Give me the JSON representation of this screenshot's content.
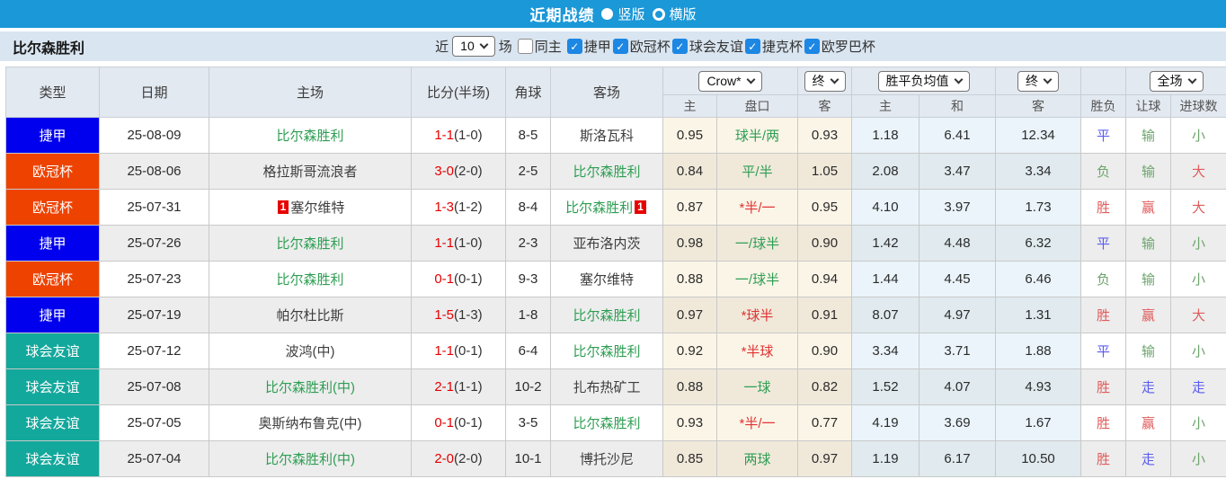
{
  "title_bar": {
    "title": "近期战绩",
    "options": [
      {
        "label": "竖版",
        "selected": true
      },
      {
        "label": "横版",
        "selected": false
      }
    ]
  },
  "filter_bar": {
    "team_name": "比尔森胜利",
    "recent_prefix": "近",
    "recent_count": "10",
    "recent_suffix": "场",
    "same_venue": {
      "label": "同主",
      "checked": false
    },
    "league_filters": [
      {
        "label": "捷甲",
        "checked": true
      },
      {
        "label": "欧冠杯",
        "checked": true
      },
      {
        "label": "球会友谊",
        "checked": true
      },
      {
        "label": "捷克杯",
        "checked": true
      },
      {
        "label": "欧罗巴杯",
        "checked": true
      }
    ]
  },
  "table": {
    "main_headers": [
      "类型",
      "日期",
      "主场",
      "比分(半场)",
      "角球",
      "客场"
    ],
    "selects": {
      "odds_company": "Crow*",
      "odds_time": "终",
      "mean_label": "胜平负均值",
      "mean_time": "终",
      "scope": "全场"
    },
    "sub_headers": [
      "主",
      "盘口",
      "客",
      "主",
      "和",
      "客",
      "胜负",
      "让球",
      "进球数"
    ],
    "league_colors": {
      "捷甲": "#0000ee",
      "欧冠杯": "#ee4300",
      "球会友谊": "#13a89c"
    },
    "rows": [
      {
        "type": "捷甲",
        "date": "25-08-09",
        "home": {
          "name": "比尔森胜利",
          "focus": true,
          "badge": ""
        },
        "score": "1-1",
        "half": "(1-0)",
        "corners": "8-5",
        "away": {
          "name": "斯洛瓦科",
          "focus": false,
          "badge": ""
        },
        "crow": {
          "home": "0.95",
          "handicap": "球半/两",
          "handicap_tone": "green",
          "away": "0.93"
        },
        "mean": {
          "home": "1.18",
          "draw": "6.41",
          "away": "12.34"
        },
        "results": {
          "outcome": {
            "text": "平",
            "tone": "blue"
          },
          "handicap": {
            "text": "输",
            "tone": "green"
          },
          "goals": {
            "text": "小",
            "tone": "green"
          }
        }
      },
      {
        "type": "欧冠杯",
        "date": "25-08-06",
        "home": {
          "name": "格拉斯哥流浪者",
          "focus": false,
          "badge": ""
        },
        "score": "3-0",
        "half": "(2-0)",
        "corners": "2-5",
        "away": {
          "name": "比尔森胜利",
          "focus": true,
          "badge": ""
        },
        "crow": {
          "home": "0.84",
          "handicap": "平/半",
          "handicap_tone": "green",
          "away": "1.05"
        },
        "mean": {
          "home": "2.08",
          "draw": "3.47",
          "away": "3.34"
        },
        "results": {
          "outcome": {
            "text": "负",
            "tone": "green"
          },
          "handicap": {
            "text": "输",
            "tone": "green"
          },
          "goals": {
            "text": "大",
            "tone": "red"
          }
        }
      },
      {
        "type": "欧冠杯",
        "date": "25-07-31",
        "home": {
          "name": "塞尔维特",
          "focus": false,
          "badge": "1"
        },
        "score": "1-3",
        "half": "(1-2)",
        "corners": "8-4",
        "away": {
          "name": "比尔森胜利",
          "focus": true,
          "badge": "1"
        },
        "crow": {
          "home": "0.87",
          "handicap": "*半/一",
          "handicap_tone": "red",
          "away": "0.95"
        },
        "mean": {
          "home": "4.10",
          "draw": "3.97",
          "away": "1.73"
        },
        "results": {
          "outcome": {
            "text": "胜",
            "tone": "red"
          },
          "handicap": {
            "text": "赢",
            "tone": "red"
          },
          "goals": {
            "text": "大",
            "tone": "red"
          }
        }
      },
      {
        "type": "捷甲",
        "date": "25-07-26",
        "home": {
          "name": "比尔森胜利",
          "focus": true,
          "badge": ""
        },
        "score": "1-1",
        "half": "(1-0)",
        "corners": "2-3",
        "away": {
          "name": "亚布洛内茨",
          "focus": false,
          "badge": ""
        },
        "crow": {
          "home": "0.98",
          "handicap": "一/球半",
          "handicap_tone": "green",
          "away": "0.90"
        },
        "mean": {
          "home": "1.42",
          "draw": "4.48",
          "away": "6.32"
        },
        "results": {
          "outcome": {
            "text": "平",
            "tone": "blue"
          },
          "handicap": {
            "text": "输",
            "tone": "green"
          },
          "goals": {
            "text": "小",
            "tone": "green"
          }
        }
      },
      {
        "type": "欧冠杯",
        "date": "25-07-23",
        "home": {
          "name": "比尔森胜利",
          "focus": true,
          "badge": ""
        },
        "score": "0-1",
        "half": "(0-1)",
        "corners": "9-3",
        "away": {
          "name": "塞尔维特",
          "focus": false,
          "badge": ""
        },
        "crow": {
          "home": "0.88",
          "handicap": "一/球半",
          "handicap_tone": "green",
          "away": "0.94"
        },
        "mean": {
          "home": "1.44",
          "draw": "4.45",
          "away": "6.46"
        },
        "results": {
          "outcome": {
            "text": "负",
            "tone": "green"
          },
          "handicap": {
            "text": "输",
            "tone": "green"
          },
          "goals": {
            "text": "小",
            "tone": "green"
          }
        }
      },
      {
        "type": "捷甲",
        "date": "25-07-19",
        "home": {
          "name": "帕尔杜比斯",
          "focus": false,
          "badge": ""
        },
        "score": "1-5",
        "half": "(1-3)",
        "corners": "1-8",
        "away": {
          "name": "比尔森胜利",
          "focus": true,
          "badge": ""
        },
        "crow": {
          "home": "0.97",
          "handicap": "*球半",
          "handicap_tone": "red",
          "away": "0.91"
        },
        "mean": {
          "home": "8.07",
          "draw": "4.97",
          "away": "1.31"
        },
        "results": {
          "outcome": {
            "text": "胜",
            "tone": "red"
          },
          "handicap": {
            "text": "赢",
            "tone": "red"
          },
          "goals": {
            "text": "大",
            "tone": "red"
          }
        }
      },
      {
        "type": "球会友谊",
        "date": "25-07-12",
        "home": {
          "name": "波鸿(中)",
          "focus": false,
          "badge": ""
        },
        "score": "1-1",
        "half": "(0-1)",
        "corners": "6-4",
        "away": {
          "name": "比尔森胜利",
          "focus": true,
          "badge": ""
        },
        "crow": {
          "home": "0.92",
          "handicap": "*半球",
          "handicap_tone": "red",
          "away": "0.90"
        },
        "mean": {
          "home": "3.34",
          "draw": "3.71",
          "away": "1.88"
        },
        "results": {
          "outcome": {
            "text": "平",
            "tone": "blue"
          },
          "handicap": {
            "text": "输",
            "tone": "green"
          },
          "goals": {
            "text": "小",
            "tone": "green"
          }
        }
      },
      {
        "type": "球会友谊",
        "date": "25-07-08",
        "home": {
          "name": "比尔森胜利(中)",
          "focus": true,
          "badge": ""
        },
        "score": "2-1",
        "half": "(1-1)",
        "corners": "10-2",
        "away": {
          "name": "扎布热矿工",
          "focus": false,
          "badge": ""
        },
        "crow": {
          "home": "0.88",
          "handicap": "一球",
          "handicap_tone": "green",
          "away": "0.82"
        },
        "mean": {
          "home": "1.52",
          "draw": "4.07",
          "away": "4.93"
        },
        "results": {
          "outcome": {
            "text": "胜",
            "tone": "red"
          },
          "handicap": {
            "text": "走",
            "tone": "blue"
          },
          "goals": {
            "text": "走",
            "tone": "blue"
          }
        }
      },
      {
        "type": "球会友谊",
        "date": "25-07-05",
        "home": {
          "name": "奥斯纳布鲁克(中)",
          "focus": false,
          "badge": ""
        },
        "score": "0-1",
        "half": "(0-1)",
        "corners": "3-5",
        "away": {
          "name": "比尔森胜利",
          "focus": true,
          "badge": ""
        },
        "crow": {
          "home": "0.93",
          "handicap": "*半/一",
          "handicap_tone": "red",
          "away": "0.77"
        },
        "mean": {
          "home": "4.19",
          "draw": "3.69",
          "away": "1.67"
        },
        "results": {
          "outcome": {
            "text": "胜",
            "tone": "red"
          },
          "handicap": {
            "text": "赢",
            "tone": "red"
          },
          "goals": {
            "text": "小",
            "tone": "green"
          }
        }
      },
      {
        "type": "球会友谊",
        "date": "25-07-04",
        "home": {
          "name": "比尔森胜利(中)",
          "focus": true,
          "badge": ""
        },
        "score": "2-0",
        "half": "(2-0)",
        "corners": "10-1",
        "away": {
          "name": "博托沙尼",
          "focus": false,
          "badge": ""
        },
        "crow": {
          "home": "0.85",
          "handicap": "两球",
          "handicap_tone": "green",
          "away": "0.97"
        },
        "mean": {
          "home": "1.19",
          "draw": "6.17",
          "away": "10.50"
        },
        "results": {
          "outcome": {
            "text": "胜",
            "tone": "red"
          },
          "handicap": {
            "text": "走",
            "tone": "blue"
          },
          "goals": {
            "text": "小",
            "tone": "green"
          }
        }
      }
    ]
  },
  "colors": {
    "titlebar_blue": "#1b98d7",
    "filterbar_bg": "#d9e5f0",
    "header_bg": "#e3e9f0",
    "checkbox_blue": "#1d87e4",
    "focus_team_green": "#2e9e53",
    "score_red": "#e60000",
    "win_red": "#e05c5c",
    "lose_green": "#6da46d",
    "draw_blue": "#5c5cf0",
    "league_jieja_blue": "#0000ee",
    "league_ucl_orange": "#ee4300",
    "league_friendly_teal": "#13a89c"
  }
}
